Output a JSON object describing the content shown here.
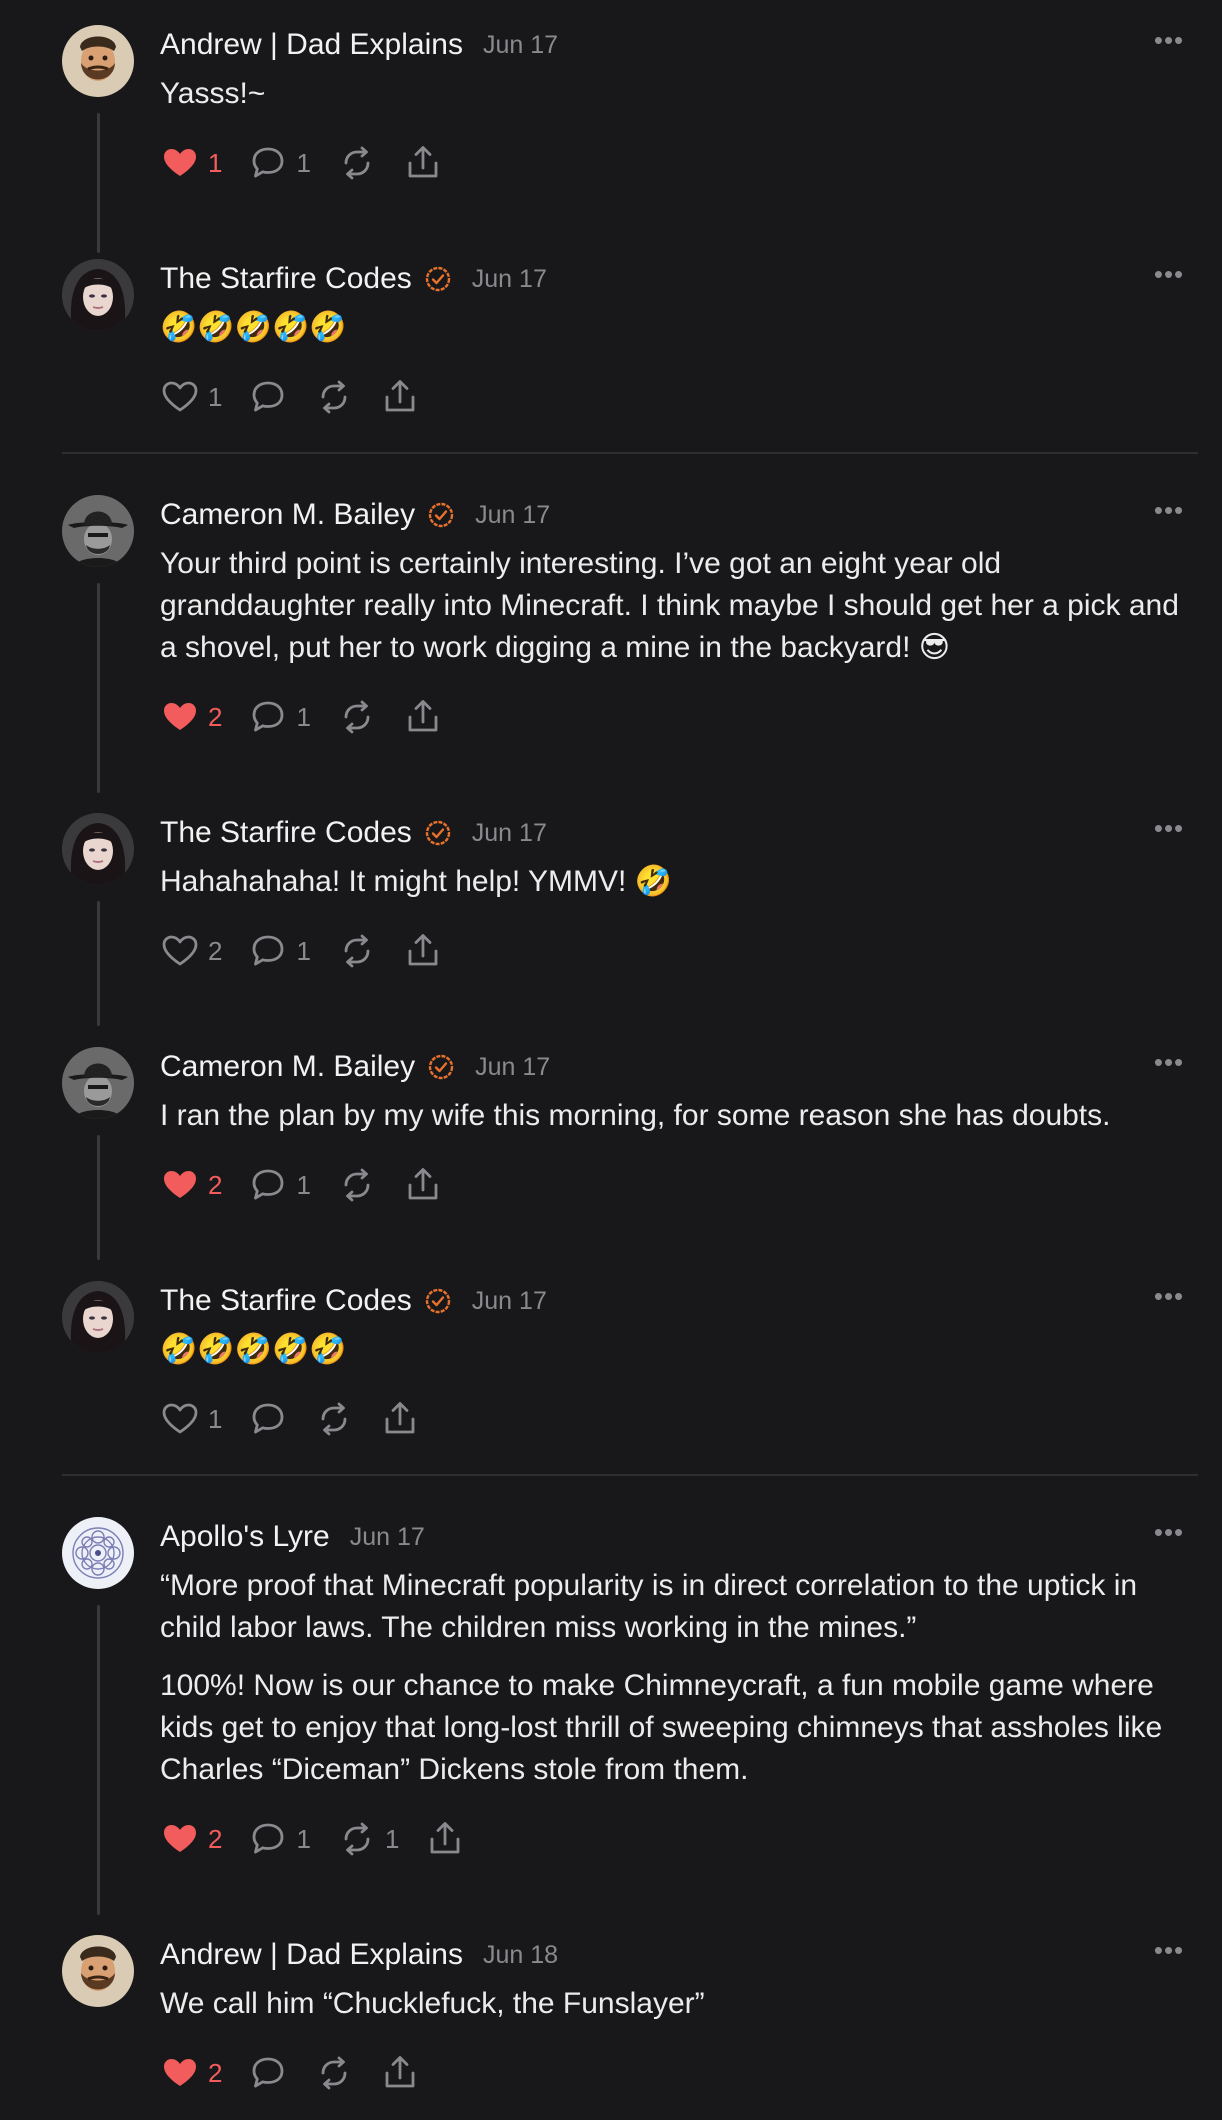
{
  "colors": {
    "background": "#18181a",
    "like_red": "#f25c5c",
    "verified_orange": "#e8722c",
    "muted": "#8a8a8e"
  },
  "icons": {
    "like": "heart-icon",
    "reply": "speech-bubble-icon",
    "repost": "repost-icon",
    "share": "share-icon",
    "more": "ellipsis-icon",
    "verified": "verified-badge-icon"
  },
  "comments": [
    {
      "author": "Andrew | Dad Explains",
      "verified": false,
      "date": "Jun 17",
      "text": [
        "Yasss!~"
      ],
      "likes": "1",
      "liked": true,
      "replies": "1",
      "reposts": ""
    },
    {
      "author": "The Starfire Codes",
      "verified": true,
      "date": "Jun 17",
      "text": [
        "🤣🤣🤣🤣🤣"
      ],
      "likes": "1",
      "liked": false,
      "replies": "",
      "reposts": ""
    },
    {
      "author": "Cameron M. Bailey",
      "verified": true,
      "date": "Jun 17",
      "text": [
        "Your third point is certainly interesting. I’ve got an eight year old granddaughter really into Minecraft. I think maybe I should get her a pick and a shovel, put her to work digging a mine in the backyard! 😎"
      ],
      "likes": "2",
      "liked": true,
      "replies": "1",
      "reposts": ""
    },
    {
      "author": "The Starfire Codes",
      "verified": true,
      "date": "Jun 17",
      "text": [
        "Hahahahaha! It might help! YMMV! 🤣"
      ],
      "likes": "2",
      "liked": false,
      "replies": "1",
      "reposts": ""
    },
    {
      "author": "Cameron M. Bailey",
      "verified": true,
      "date": "Jun 17",
      "text": [
        "I ran the plan by my wife this morning, for some reason she has doubts."
      ],
      "likes": "2",
      "liked": true,
      "replies": "1",
      "reposts": ""
    },
    {
      "author": "The Starfire Codes",
      "verified": true,
      "date": "Jun 17",
      "text": [
        "🤣🤣🤣🤣🤣"
      ],
      "likes": "1",
      "liked": false,
      "replies": "",
      "reposts": ""
    },
    {
      "author": "Apollo's Lyre",
      "verified": false,
      "date": "Jun 17",
      "text": [
        "“More proof that Minecraft popularity is in direct correlation to the uptick in child labor laws. The children miss working in the mines.”",
        "100%! Now is our chance to make Chimneycraft, a fun mobile game where kids get to enjoy that long-lost thrill of sweeping chimneys that assholes like Charles “Diceman” Dickens stole from them."
      ],
      "likes": "2",
      "liked": true,
      "replies": "1",
      "reposts": "1"
    },
    {
      "author": "Andrew | Dad Explains",
      "verified": false,
      "date": "Jun 18",
      "text": [
        "We call him “Chucklefuck, the Funslayer”"
      ],
      "likes": "2",
      "liked": true,
      "replies": "",
      "reposts": ""
    }
  ]
}
